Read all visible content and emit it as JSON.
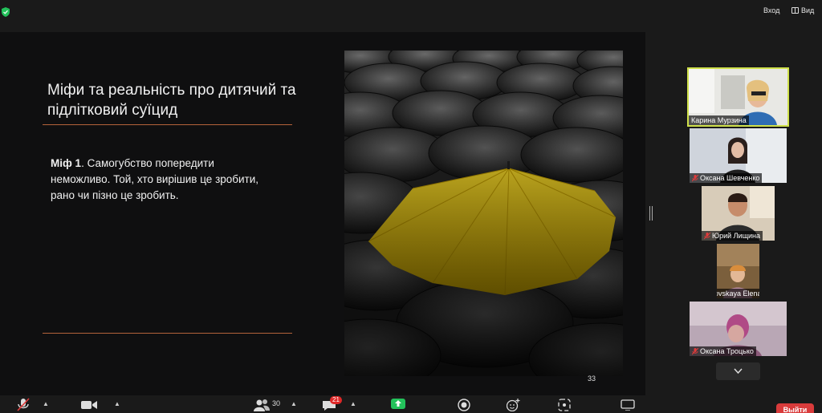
{
  "topbar": {
    "signin_label": "Вход",
    "view_label": "Вид"
  },
  "slide": {
    "title": "Міфи та реальність про дитячий та підлітковий суїцид",
    "myth_label": "Міф 1",
    "myth_text": ". Самогубство попередити неможливо. Той, хто вирішив це зробити, рано чи пізно це зробить.",
    "page_number": "33"
  },
  "participants": [
    {
      "name": "Карина Мурзина",
      "muted": false,
      "active": true
    },
    {
      "name": "Оксана Шевченко",
      "muted": true,
      "active": false
    },
    {
      "name": "Юрий Лищина",
      "muted": true,
      "active": false
    },
    {
      "name": "Boldovskaya Elena",
      "muted": true,
      "active": false
    },
    {
      "name": "Оксана Троцько",
      "muted": true,
      "active": false
    }
  ],
  "toolbar": {
    "participants_count": "30",
    "chat_badge": "21",
    "leave_label": "Выйти"
  },
  "colors": {
    "accent_rule": "#b4633a",
    "active_speaker": "#cfe04a",
    "leave": "#d93b3b",
    "share": "#23c25b"
  }
}
